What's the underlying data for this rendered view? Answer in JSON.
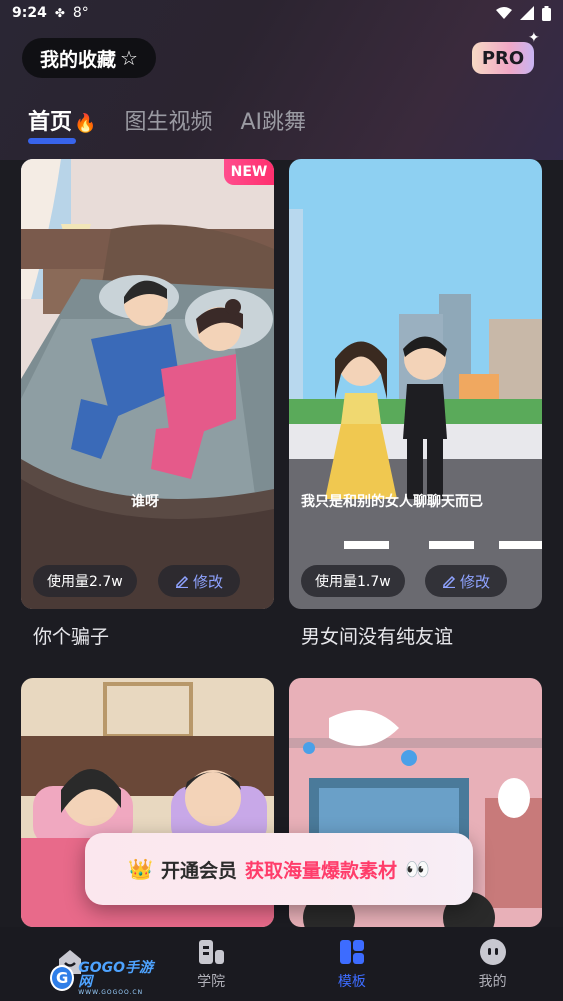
{
  "status": {
    "time": "9:24",
    "temp": "8°"
  },
  "header": {
    "favorites_label": "我的收藏",
    "pro_label": "PRO"
  },
  "tabs": [
    {
      "label": "首页"
    },
    {
      "label": "图生视频"
    },
    {
      "label": "AI跳舞"
    }
  ],
  "cards": [
    {
      "title": "你个骗子",
      "usage": "使用量2.7w",
      "edit": "修改",
      "badge": "NEW",
      "caption": "谁呀"
    },
    {
      "title": "男女间没有纯友谊",
      "usage": "使用量1.7w",
      "edit": "修改",
      "caption": "我只是和别的女人聊聊天而已"
    }
  ],
  "banner": {
    "prefix": "开通会员",
    "highlight": "获取海量爆款素材"
  },
  "nav": [
    {
      "label": ""
    },
    {
      "label": "学院"
    },
    {
      "label": "模板"
    },
    {
      "label": "我的"
    }
  ],
  "watermark": {
    "brand": "GOGO手游网",
    "sub": "WWW.GOGOO.CN"
  },
  "colors": {
    "accent": "#3d6cff",
    "new_badge": "#ff2f6e",
    "banner_highlight": "#ff3d6b"
  }
}
